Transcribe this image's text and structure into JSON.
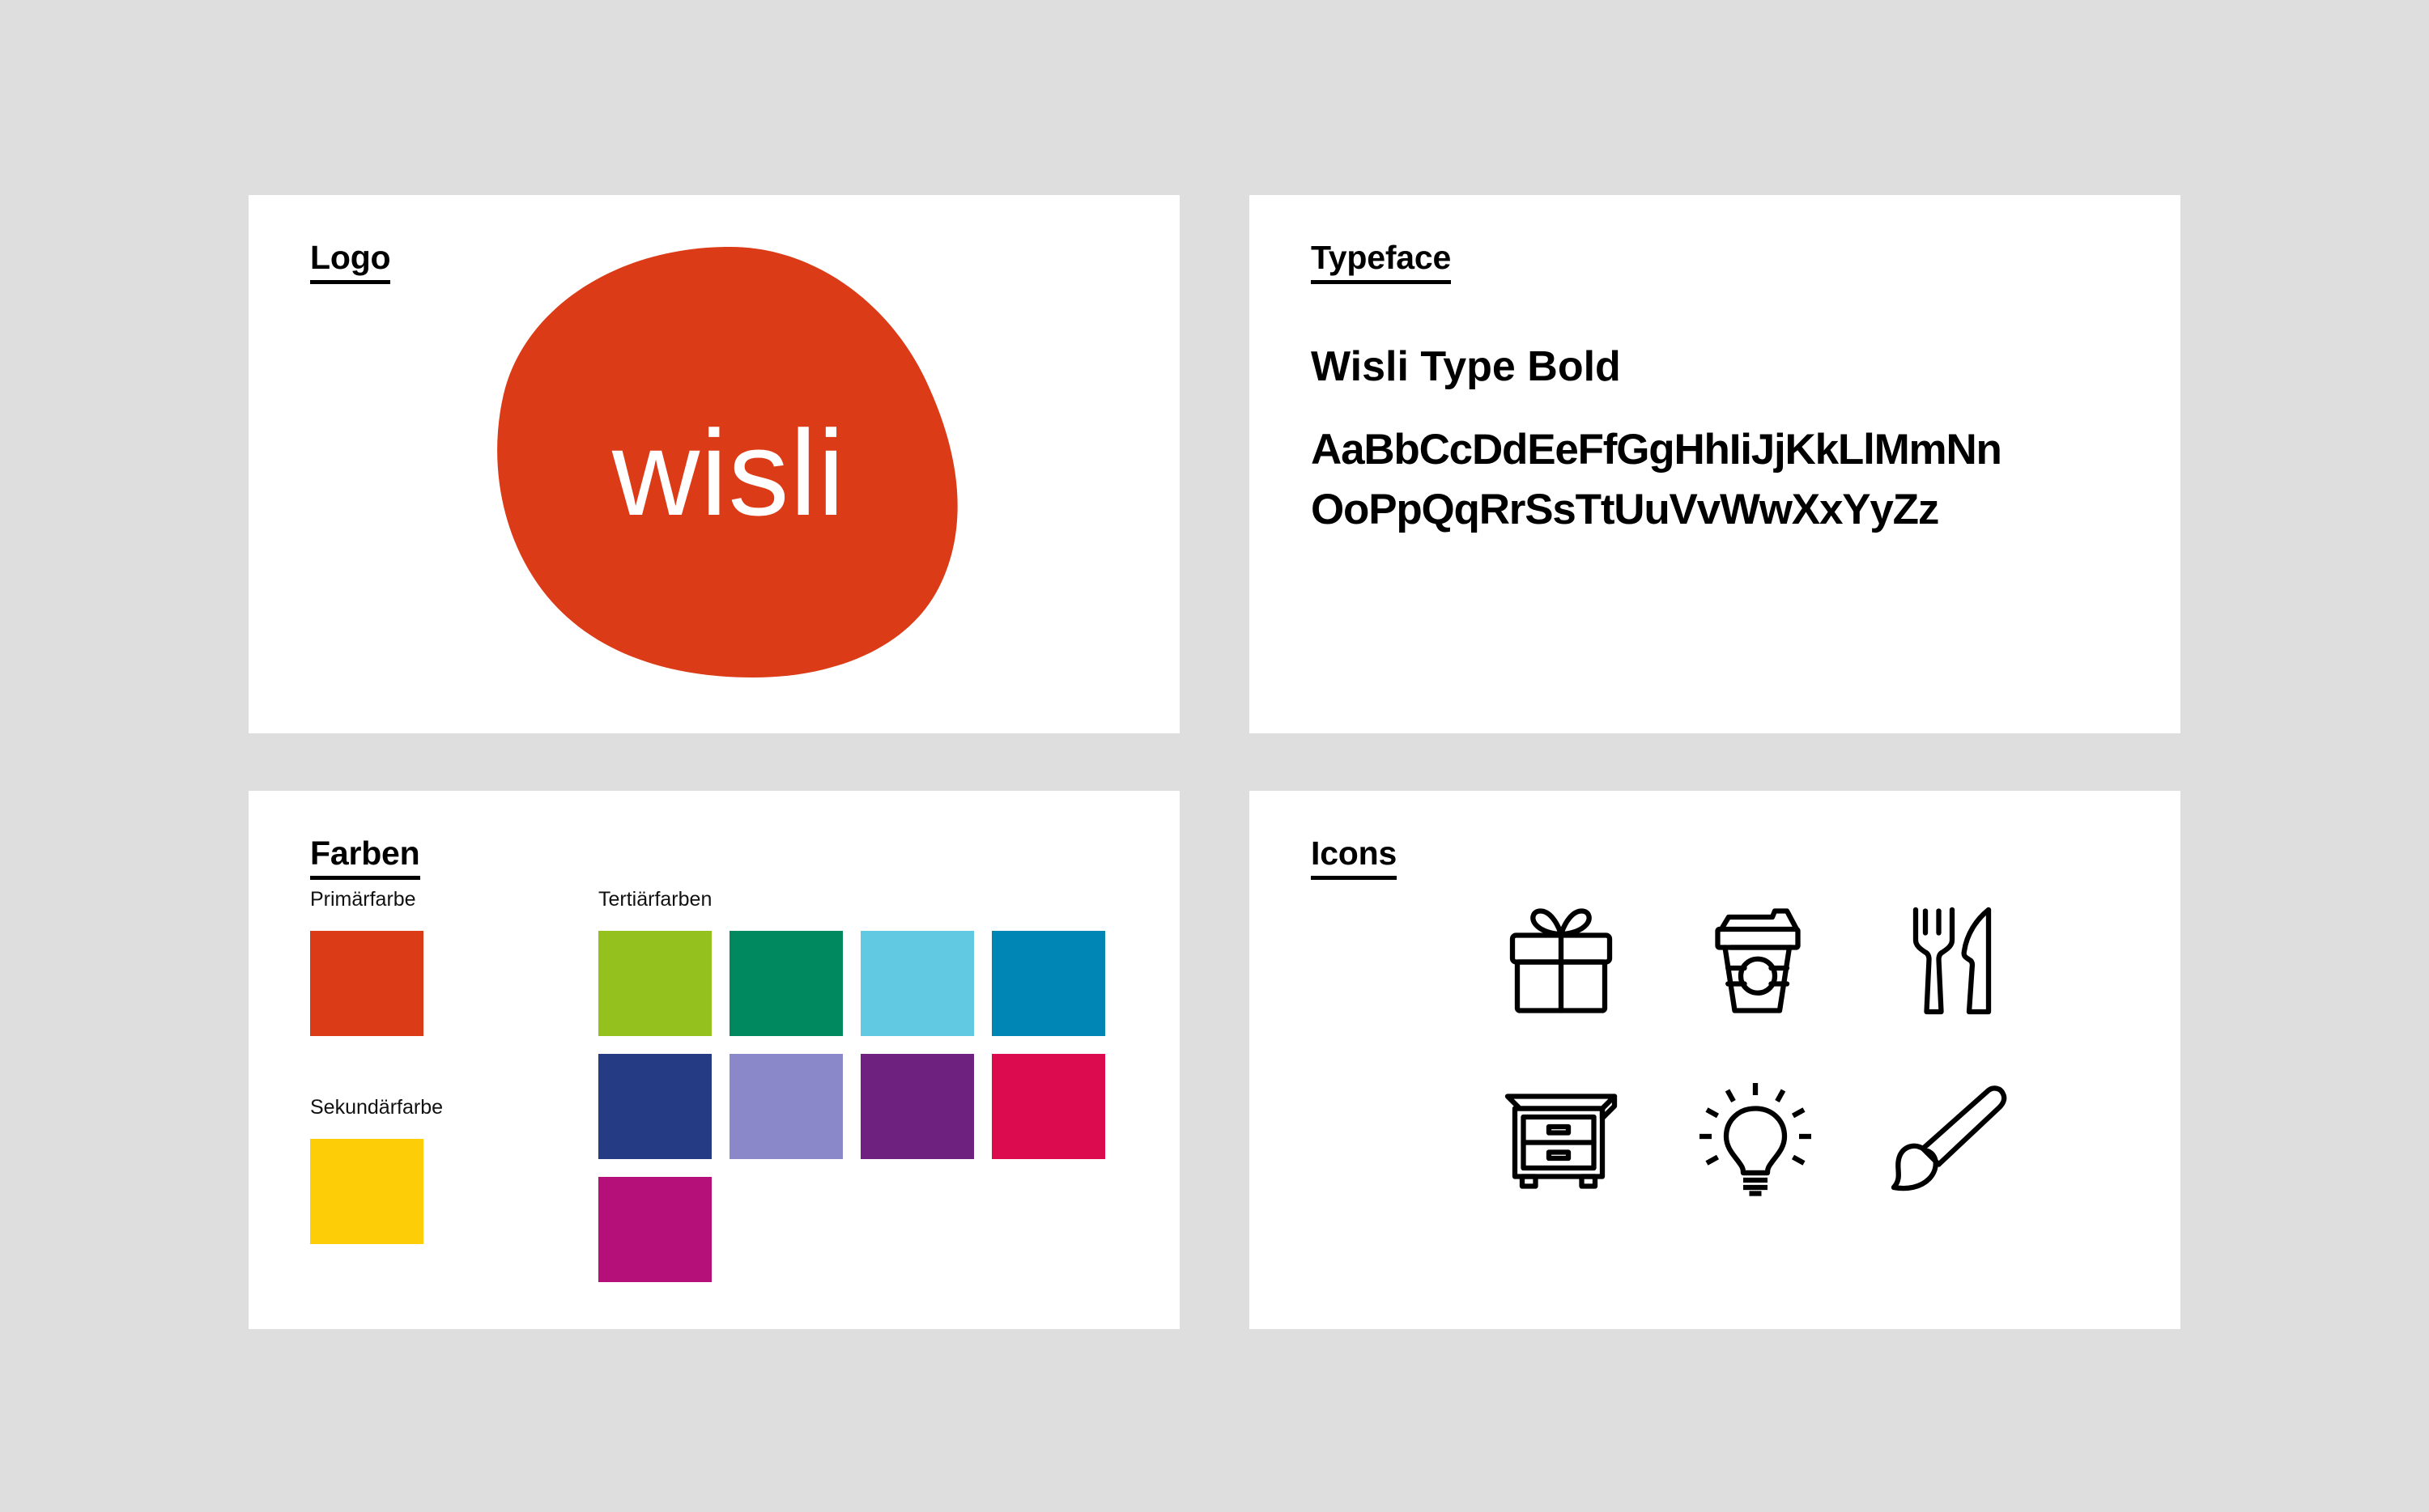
{
  "page": {
    "background_color": "#dedede",
    "panel_background": "#ffffff"
  },
  "logo_panel": {
    "heading": "Logo",
    "wordmark": "wisli",
    "blob_color": "#dc3b17",
    "wordmark_color": "#ffffff",
    "shape_name": "organic-blob"
  },
  "typeface_panel": {
    "heading": "Typeface",
    "type_name": "Wisli Type Bold",
    "alphabet_upper": "AaBbCcDdEeFfGgHhIiJjKkLlMmNn",
    "alphabet_lower": "OoPpQqRrSsTtUuVvWwXxYyZz"
  },
  "colors_panel": {
    "heading": "Farben",
    "primary_label": "Primärfarbe",
    "secondary_label": "Sekundärfarbe",
    "tertiary_label": "Tertiärfarben",
    "primary_color": "#dc3b17",
    "secondary_color": "#fdcd07",
    "tertiary_colors": [
      "#95c11f",
      "#00895e",
      "#62c9e3",
      "#0086b5",
      "#253b84",
      "#8a88c8",
      "#6f2180",
      "#dc0a4e",
      "#b5107a"
    ]
  },
  "icons_panel": {
    "heading": "Icons",
    "icon_color": "#000000",
    "icons": [
      {
        "name": "gift-icon",
        "label": "gift"
      },
      {
        "name": "coffee-cup-icon",
        "label": "coffee cup"
      },
      {
        "name": "cutlery-icon",
        "label": "fork and knife"
      },
      {
        "name": "nightstand-icon",
        "label": "nightstand"
      },
      {
        "name": "lightbulb-icon",
        "label": "lightbulb"
      },
      {
        "name": "paintbrush-icon",
        "label": "paintbrush"
      }
    ]
  }
}
